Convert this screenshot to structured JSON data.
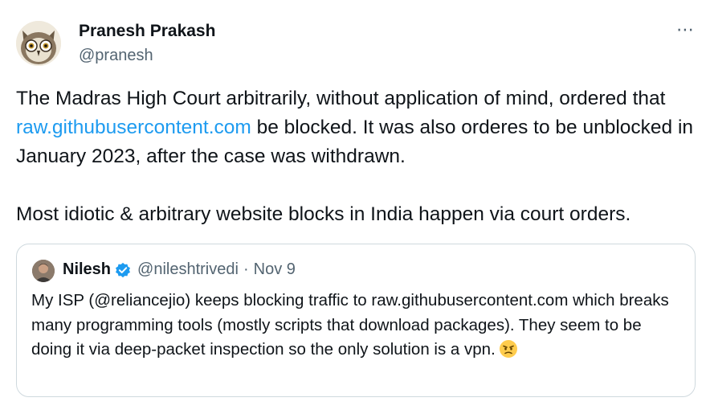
{
  "author": {
    "display_name": "Pranesh Prakash",
    "handle": "@pranesh",
    "avatar_icon": "owl-avatar-icon"
  },
  "more_icon": "⋯",
  "tweet": {
    "line1_prefix": "The Madras High Court arbitrarily, without application of mind, ordered that ",
    "link_text": "raw.githubusercontent.com",
    "line1_suffix": " be blocked. It was also orderes to be unblocked in January 2023, after the case was withdrawn.",
    "line2": "Most idiotic & arbitrary website blocks in India happen via court orders."
  },
  "quote": {
    "display_name": "Nilesh",
    "handle": "@nileshtrivedi",
    "dot": "·",
    "date": "Nov 9",
    "text": "My ISP (@reliancejio) keeps blocking traffic to raw.githubusercontent.com which breaks many programming tools (mostly scripts that download packages). They seem to be doing it via deep-packet inspection so the only solution is a vpn.",
    "emoji_icon": "angry-face-icon"
  },
  "colors": {
    "link": "#1d9bf0",
    "text": "#0f1419",
    "muted": "#536471",
    "border": "#cfd9de",
    "verified": "#1d9bf0"
  }
}
